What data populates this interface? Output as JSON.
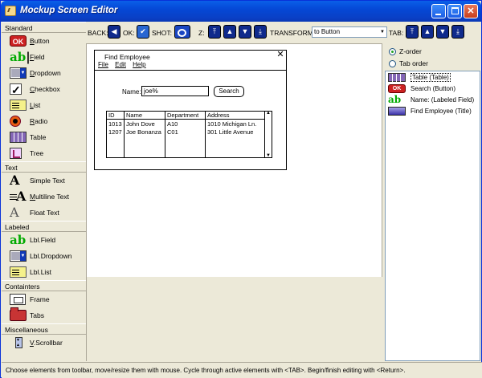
{
  "window": {
    "title": "Mockup Screen Editor"
  },
  "palette": {
    "sections": [
      {
        "label": "Standard",
        "items": [
          {
            "icon": "button-icon",
            "label": "Button",
            "u": "B",
            "rest": "utton"
          },
          {
            "icon": "field-icon",
            "label": "Field",
            "u": "F",
            "rest": "ield"
          },
          {
            "icon": "dropdown-icon",
            "label": "Dropdown",
            "u": "D",
            "rest": "ropdown"
          },
          {
            "icon": "checkbox-icon",
            "label": "Checkbox",
            "u": "C",
            "rest": "heckbox"
          },
          {
            "icon": "list-icon",
            "label": "List",
            "u": "L",
            "rest": "ist"
          },
          {
            "icon": "radio-icon",
            "label": "Radio",
            "u": "R",
            "rest": "adio"
          },
          {
            "icon": "table-icon",
            "label": "Table",
            "u": "",
            "rest": "Table"
          },
          {
            "icon": "tree-icon",
            "label": "Tree",
            "u": "",
            "rest": "Tree"
          }
        ]
      },
      {
        "label": "Text",
        "items": [
          {
            "icon": "simple-text-icon",
            "label": "Simple Text",
            "u": "",
            "rest": "Simple Text"
          },
          {
            "icon": "multiline-text-icon",
            "label": "Multiline Text",
            "u": "M",
            "rest": "ultiline Text"
          },
          {
            "icon": "float-text-icon",
            "label": "Float Text",
            "u": "",
            "rest": "Float Text"
          }
        ]
      },
      {
        "label": "Labeled",
        "items": [
          {
            "icon": "labeled-field-icon",
            "label": "Lbl.Field",
            "u": "",
            "rest": "Lbl.Field"
          },
          {
            "icon": "labeled-dropdown-icon",
            "label": "Lbl.Dropdown",
            "u": "",
            "rest": "Lbl.Dropdown"
          },
          {
            "icon": "labeled-list-icon",
            "label": "Lbl.List",
            "u": "",
            "rest": "Lbl.List"
          }
        ]
      },
      {
        "label": "Containters",
        "items": [
          {
            "icon": "frame-icon",
            "label": "Frame",
            "u": "",
            "rest": "Frame"
          },
          {
            "icon": "tabs-icon",
            "label": "Tabs",
            "u": "",
            "rest": "Tabs"
          }
        ]
      },
      {
        "label": "Miscellaneous",
        "items": [
          {
            "icon": "vertical-scrollbar-icon",
            "label": "V.Scrollbar",
            "u": "V",
            "rest": ".Scrollbar"
          }
        ]
      }
    ]
  },
  "toolbar": {
    "back_label": "BACK:",
    "ok_label": "OK:",
    "shot_label": "SHOT:",
    "z_label": "Z:",
    "transform_label": "TRANSFORM:",
    "transform_value": "to Button",
    "tab_label": "TAB:"
  },
  "mock": {
    "title": "Find Employee",
    "close_glyph": "✕",
    "menu": [
      "File",
      "Edit",
      "Help"
    ],
    "name_label": "Name:",
    "name_value": "joe%",
    "search_label": "Search",
    "table": {
      "headers": [
        "ID",
        "Name",
        "Department",
        "Address"
      ],
      "rows": [
        [
          "1013",
          "John Dove",
          "A10",
          "1010 Michigan Ln."
        ],
        [
          "1207",
          "Joe Bonanza",
          "C01",
          "301 Little Avenue"
        ]
      ]
    }
  },
  "order_panel": {
    "z_order_label": "Z-order",
    "tab_order_label": "Tab order",
    "selected_mode": "z-order",
    "items": [
      {
        "icon": "table-icon",
        "text": "Table (Table)",
        "selected": true
      },
      {
        "icon": "button-icon",
        "text": "Search (Button)",
        "selected": false
      },
      {
        "icon": "labeled-field-icon",
        "text": "Name: (Labeled Field)",
        "selected": false
      },
      {
        "icon": "title-icon",
        "text": "Find Employee (Title)",
        "selected": false
      }
    ]
  },
  "status": {
    "text": "Choose elements from toolbar, move/resize them with mouse. Cycle through active elements with <TAB>. Begin/finish editing with <Return>."
  }
}
